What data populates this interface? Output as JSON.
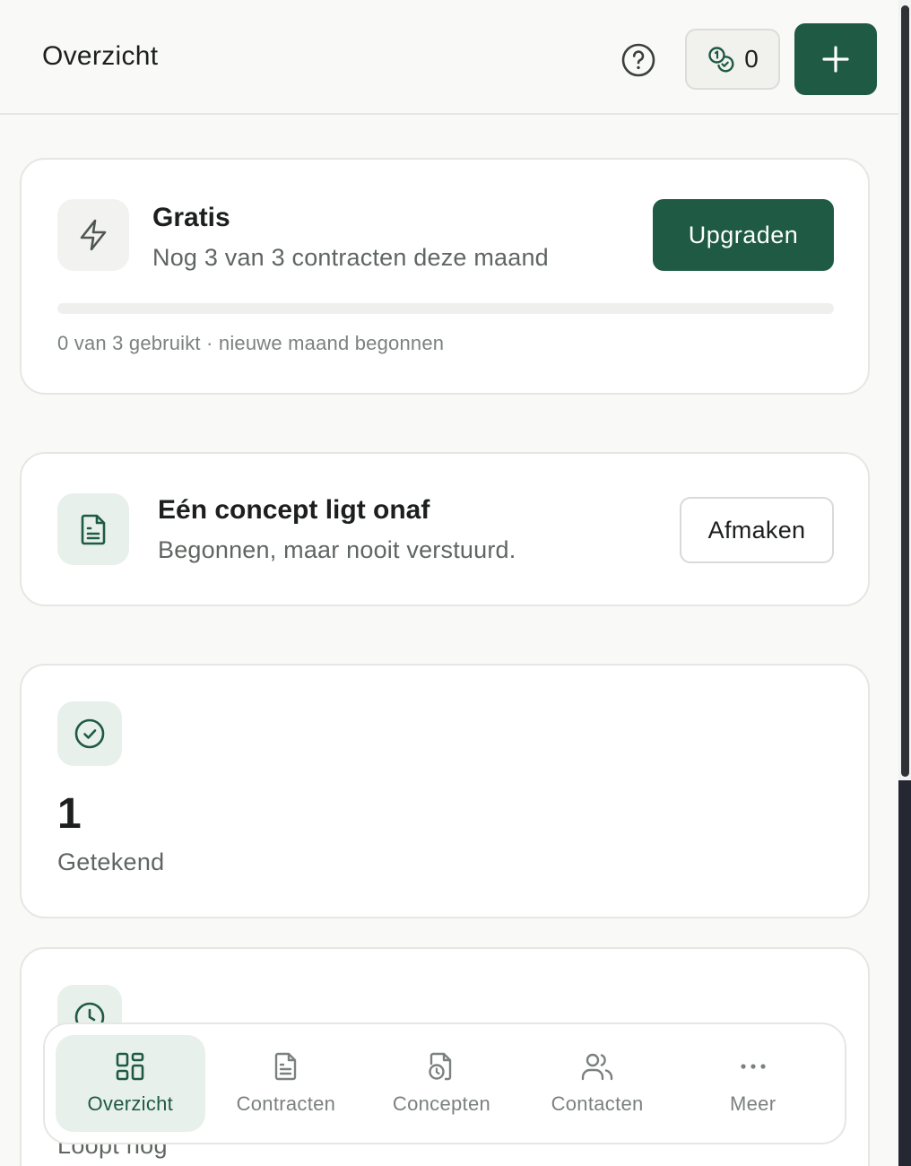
{
  "header": {
    "title": "Overzicht",
    "credits_count": "0"
  },
  "plan": {
    "name": "Gratis",
    "remaining_text": "Nog 3 van 3 contracten deze maand",
    "upgrade_label": "Upgraden",
    "usage_fraction": 0,
    "usage_note": "0 van 3 gebruikt · nieuwe maand begonnen"
  },
  "draft_notice": {
    "title": "Eén concept ligt onaf",
    "subtitle": "Begonnen, maar nooit verstuurd.",
    "action_label": "Afmaken"
  },
  "stats": {
    "signed": {
      "value": "1",
      "label": "Getekend"
    },
    "running": {
      "label": "Loopt nog"
    }
  },
  "bottom_nav": {
    "items": [
      {
        "label": "Overzicht",
        "icon": "dashboard-grid-icon",
        "active": true
      },
      {
        "label": "Contracten",
        "icon": "document-icon"
      },
      {
        "label": "Concepten",
        "icon": "draft-clock-document-icon"
      },
      {
        "label": "Contacten",
        "icon": "users-icon"
      },
      {
        "label": "Meer",
        "icon": "more-dots-icon"
      }
    ]
  },
  "colors": {
    "accent": "#1e5a44",
    "accent_soft": "#e8f0eb",
    "background": "#f9f9f7",
    "muted_text": "#5f6662"
  }
}
